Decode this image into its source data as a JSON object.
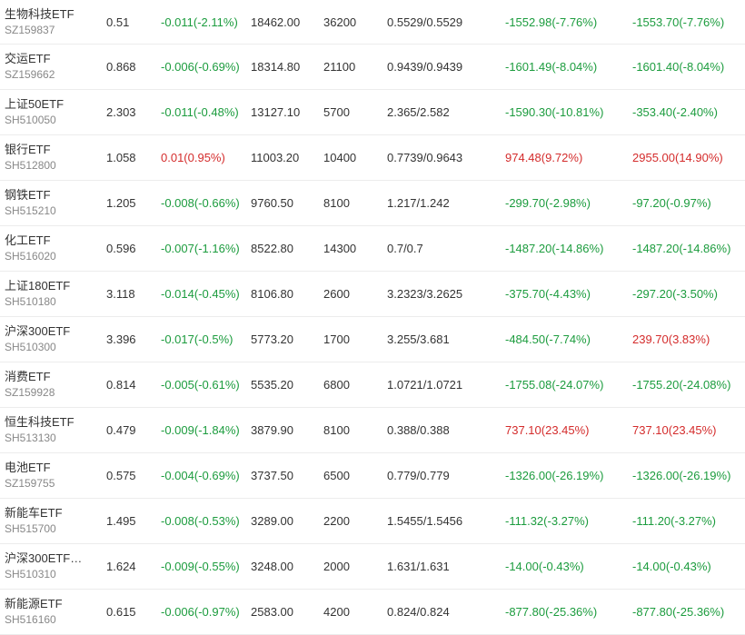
{
  "colors": {
    "up": "#d42c2c",
    "down": "#1c9c3e",
    "text": "#333333",
    "muted": "#888888"
  },
  "rows": [
    {
      "name": "生物科技ETF",
      "code": "SZ159837",
      "price": "0.51",
      "change": "-0.011(-2.11%)",
      "change_dir": "neg",
      "amount": "18462.00",
      "shares": "36200",
      "cost": "0.5529/0.5529",
      "today": "-1552.98(-7.76%)",
      "today_dir": "neg",
      "total": "-1553.70(-7.76%)",
      "total_dir": "neg"
    },
    {
      "name": "交运ETF",
      "code": "SZ159662",
      "price": "0.868",
      "change": "-0.006(-0.69%)",
      "change_dir": "neg",
      "amount": "18314.80",
      "shares": "21100",
      "cost": "0.9439/0.9439",
      "today": "-1601.49(-8.04%)",
      "today_dir": "neg",
      "total": "-1601.40(-8.04%)",
      "total_dir": "neg"
    },
    {
      "name": "上证50ETF",
      "code": "SH510050",
      "price": "2.303",
      "change": "-0.011(-0.48%)",
      "change_dir": "neg",
      "amount": "13127.10",
      "shares": "5700",
      "cost": "2.365/2.582",
      "today": "-1590.30(-10.81%)",
      "today_dir": "neg",
      "total": "-353.40(-2.40%)",
      "total_dir": "neg"
    },
    {
      "name": "银行ETF",
      "code": "SH512800",
      "price": "1.058",
      "change": "0.01(0.95%)",
      "change_dir": "pos",
      "amount": "11003.20",
      "shares": "10400",
      "cost": "0.7739/0.9643",
      "today": "974.48(9.72%)",
      "today_dir": "pos",
      "total": "2955.00(14.90%)",
      "total_dir": "pos"
    },
    {
      "name": "钢铁ETF",
      "code": "SH515210",
      "price": "1.205",
      "change": "-0.008(-0.66%)",
      "change_dir": "neg",
      "amount": "9760.50",
      "shares": "8100",
      "cost": "1.217/1.242",
      "today": "-299.70(-2.98%)",
      "today_dir": "neg",
      "total": "-97.20(-0.97%)",
      "total_dir": "neg"
    },
    {
      "name": "化工ETF",
      "code": "SH516020",
      "price": "0.596",
      "change": "-0.007(-1.16%)",
      "change_dir": "neg",
      "amount": "8522.80",
      "shares": "14300",
      "cost": "0.7/0.7",
      "today": "-1487.20(-14.86%)",
      "today_dir": "neg",
      "total": "-1487.20(-14.86%)",
      "total_dir": "neg"
    },
    {
      "name": "上证180ETF",
      "code": "SH510180",
      "price": "3.118",
      "change": "-0.014(-0.45%)",
      "change_dir": "neg",
      "amount": "8106.80",
      "shares": "2600",
      "cost": "3.2323/3.2625",
      "today": "-375.70(-4.43%)",
      "today_dir": "neg",
      "total": "-297.20(-3.50%)",
      "total_dir": "neg"
    },
    {
      "name": "沪深300ETF",
      "code": "SH510300",
      "price": "3.396",
      "change": "-0.017(-0.5%)",
      "change_dir": "neg",
      "amount": "5773.20",
      "shares": "1700",
      "cost": "3.255/3.681",
      "today": "-484.50(-7.74%)",
      "today_dir": "neg",
      "total": "239.70(3.83%)",
      "total_dir": "pos"
    },
    {
      "name": "消费ETF",
      "code": "SZ159928",
      "price": "0.814",
      "change": "-0.005(-0.61%)",
      "change_dir": "neg",
      "amount": "5535.20",
      "shares": "6800",
      "cost": "1.0721/1.0721",
      "today": "-1755.08(-24.07%)",
      "today_dir": "neg",
      "total": "-1755.20(-24.08%)",
      "total_dir": "neg"
    },
    {
      "name": "恒生科技ETF",
      "code": "SH513130",
      "price": "0.479",
      "change": "-0.009(-1.84%)",
      "change_dir": "neg",
      "amount": "3879.90",
      "shares": "8100",
      "cost": "0.388/0.388",
      "today": "737.10(23.45%)",
      "today_dir": "pos",
      "total": "737.10(23.45%)",
      "total_dir": "pos"
    },
    {
      "name": "电池ETF",
      "code": "SZ159755",
      "price": "0.575",
      "change": "-0.004(-0.69%)",
      "change_dir": "neg",
      "amount": "3737.50",
      "shares": "6500",
      "cost": "0.779/0.779",
      "today": "-1326.00(-26.19%)",
      "today_dir": "neg",
      "total": "-1326.00(-26.19%)",
      "total_dir": "neg"
    },
    {
      "name": "新能车ETF",
      "code": "SH515700",
      "price": "1.495",
      "change": "-0.008(-0.53%)",
      "change_dir": "neg",
      "amount": "3289.00",
      "shares": "2200",
      "cost": "1.5455/1.5456",
      "today": "-111.32(-3.27%)",
      "today_dir": "neg",
      "total": "-111.20(-3.27%)",
      "total_dir": "neg"
    },
    {
      "name": "沪深300ETF…",
      "code": "SH510310",
      "price": "1.624",
      "change": "-0.009(-0.55%)",
      "change_dir": "neg",
      "amount": "3248.00",
      "shares": "2000",
      "cost": "1.631/1.631",
      "today": "-14.00(-0.43%)",
      "today_dir": "neg",
      "total": "-14.00(-0.43%)",
      "total_dir": "neg"
    },
    {
      "name": "新能源ETF",
      "code": "SH516160",
      "price": "0.615",
      "change": "-0.006(-0.97%)",
      "change_dir": "neg",
      "amount": "2583.00",
      "shares": "4200",
      "cost": "0.824/0.824",
      "today": "-877.80(-25.36%)",
      "today_dir": "neg",
      "total": "-877.80(-25.36%)",
      "total_dir": "neg"
    }
  ]
}
